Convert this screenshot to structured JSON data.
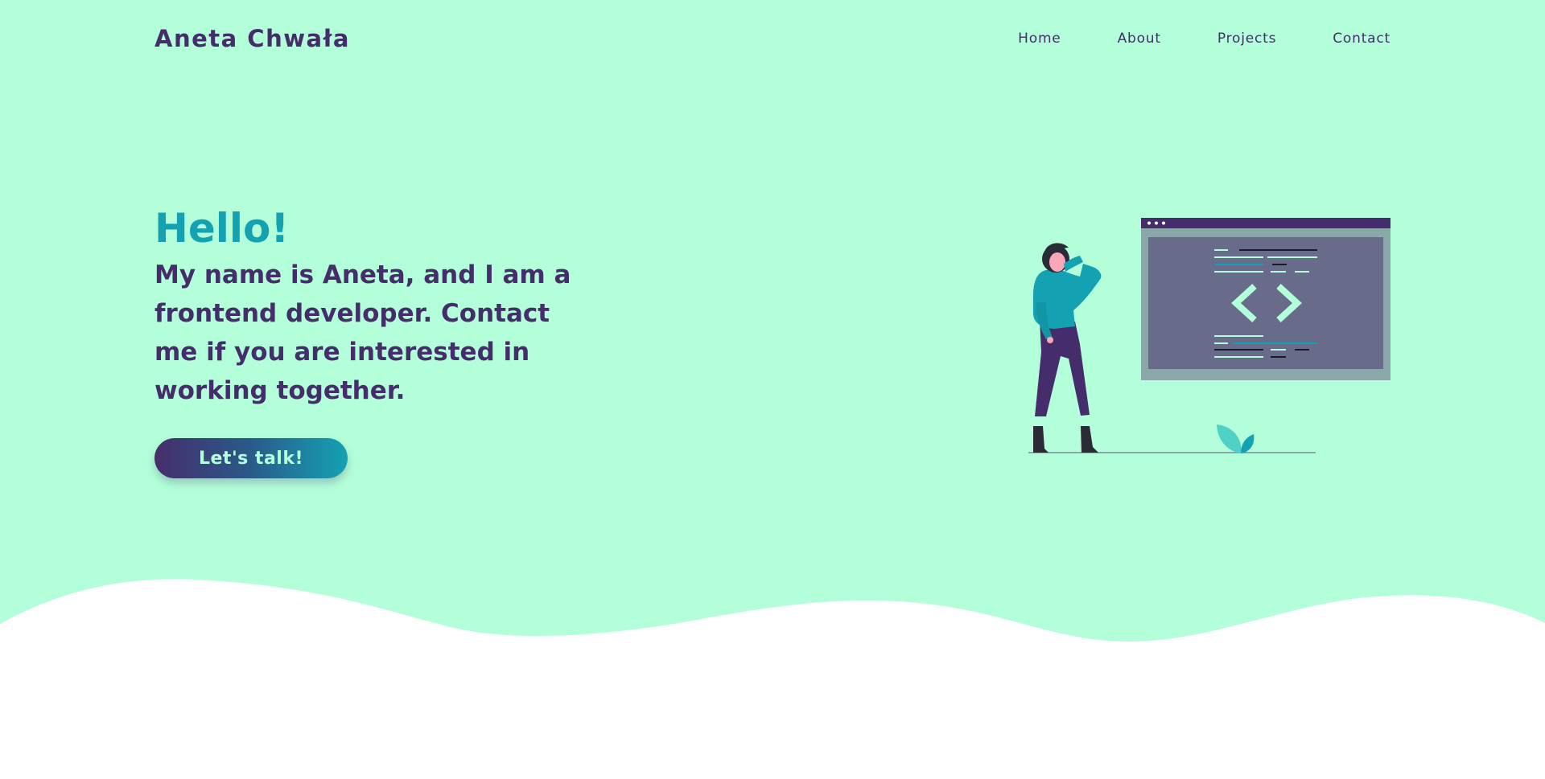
{
  "colors": {
    "background": "#b3ffd9",
    "primary": "#452d6b",
    "accent": "#14a2b3",
    "button_text": "#b3ffd9",
    "wave": "#ffffff"
  },
  "header": {
    "logo": "Aneta Chwała",
    "nav": [
      "Home",
      "About",
      "Projects",
      "Contact"
    ]
  },
  "hero": {
    "greeting": "Hello!",
    "bio": "My name is Aneta, and I am a frontend developer. Contact me if you are interested in working together.",
    "cta_label": "Let's talk!"
  },
  "illustration": {
    "icon": "woman-with-code-window-illustration"
  }
}
